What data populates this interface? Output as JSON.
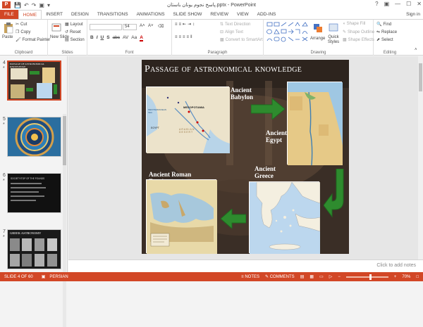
{
  "window": {
    "title": "پاسخ نجوم یونان باستان.pptx - PowerPoint",
    "controls": [
      "?",
      "▣",
      "—",
      "☐",
      "✕"
    ]
  },
  "tabs": {
    "file": "FILE",
    "items": [
      "HOME",
      "INSERT",
      "DESIGN",
      "TRANSITIONS",
      "ANIMATIONS",
      "SLIDE SHOW",
      "REVIEW",
      "VIEW",
      "ADD-INS"
    ],
    "active": "HOME",
    "signin": "Sign in"
  },
  "ribbon": {
    "clipboard": {
      "label": "Clipboard",
      "paste": "Paste",
      "cut": "Cut",
      "copy": "Copy",
      "format_painter": "Format Painter"
    },
    "slides": {
      "label": "Slides",
      "new_slide": "New Slide",
      "layout": "Layout",
      "reset": "Reset",
      "section": "Section"
    },
    "font": {
      "label": "Font",
      "size": "54",
      "bold": "B",
      "italic": "I",
      "underline": "U",
      "shadow": "S",
      "strike": "abc",
      "spacing": "AV",
      "case": "Aa",
      "color": "A"
    },
    "paragraph": {
      "label": "Paragraph",
      "text_direction": "Text Direction",
      "align_text": "Align Text",
      "smartart": "Convert to SmartArt"
    },
    "drawing": {
      "label": "Drawing",
      "arrange": "Arrange",
      "quick_styles": "Quick Styles",
      "shape_fill": "Shape Fill",
      "shape_outline": "Shape Outline",
      "shape_effects": "Shape Effects"
    },
    "editing": {
      "label": "Editing",
      "find": "Find",
      "replace": "Replace",
      "select": "Select"
    }
  },
  "thumbnails": [
    {
      "num": "4",
      "star": "*",
      "title": "PASSAGE OF ASTRONOMICAL KNOWLEDGE",
      "selected": true
    },
    {
      "num": "5",
      "star": "*",
      "title": "",
      "selected": false
    },
    {
      "num": "6",
      "star": "*",
      "title": "SOCIETY/TOP OF THE FOUNDS",
      "selected": false
    },
    {
      "num": "7",
      "star": "*",
      "title": "GREEK ASTRONOMY",
      "selected": false
    }
  ],
  "slide": {
    "title": "Passage of astronomical knowledge",
    "labels": {
      "babylon": "Ancient Babylon",
      "egypt": "Ancient Egypt",
      "greece": "Ancient Greece",
      "roman": "Ancient Roman Empire"
    },
    "map_text": {
      "mesopotamia": "MESOPOTAMIA",
      "arabian": "ARABIAN DESERT",
      "egypt": "EGYPT",
      "med": "MEDITERRANEAN SEA"
    }
  },
  "notes": {
    "placeholder": "Click to add notes"
  },
  "status": {
    "slide": "SLIDE 4 OF 60",
    "language": "PERSIAN",
    "notes": "NOTES",
    "comments": "COMMENTS",
    "zoom": "70%"
  },
  "colors": {
    "accent": "#d24726",
    "arrow_green": "#2e8b2e",
    "slide_bg": "#2a221d"
  }
}
